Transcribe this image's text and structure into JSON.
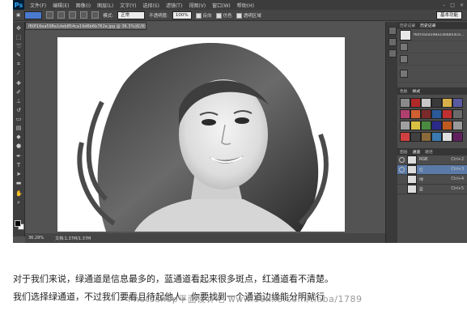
{
  "menubar": {
    "logo": "Ps",
    "items": [
      "文件(F)",
      "编辑(E)",
      "图像(I)",
      "图层(L)",
      "文字(Y)",
      "选择(S)",
      "滤镜(T)",
      "视图(V)",
      "窗口(W)",
      "帮助(H)"
    ],
    "window_controls": [
      "–",
      "□",
      "×"
    ]
  },
  "options": {
    "mode_label": "模式:",
    "mode_value": "正常",
    "opacity_label": "不透明度:",
    "opacity_value": "100%",
    "cb1": "反向",
    "cb2": "仿色",
    "cb3": "透明区域",
    "workspace": "基本功能"
  },
  "document": {
    "tab_title": "f60f16ea598a1deb854ca19d6b6b762e.jpg @ 36.3%(红/8)",
    "zoom": "36.29%",
    "doc_info": "文档:1.37M/1.37M"
  },
  "history": {
    "tabs": [
      "历史记录",
      "历史记录"
    ],
    "rows": [
      "f60f16ea598a1deb854ca...",
      "",
      "",
      ""
    ]
  },
  "styles": {
    "tabs": [
      "色板",
      "样式"
    ],
    "colors": [
      "#8a8a8a",
      "#b02a2a",
      "#c8c8c8",
      "#3a3a3a",
      "#d8b04a",
      "#5a5aa0",
      "#b04070",
      "#d06030",
      "#7a2a2a",
      "#2a5a9a",
      "#c03030",
      "#6a6a6a",
      "#a0a0a0",
      "#d8c040",
      "#4a8a40",
      "#2a2a8a",
      "#c05a20",
      "#9a9a9a",
      "#d04040",
      "#404040",
      "#8a6a3a",
      "#3a7ab0",
      "#e0e0e0",
      "#602060"
    ]
  },
  "channels": {
    "tabs": [
      "图层",
      "通道",
      "路径"
    ],
    "rows": [
      {
        "name": "RGB",
        "key": "Ctrl+2"
      },
      {
        "name": "红",
        "key": "Ctrl+3"
      },
      {
        "name": "绿",
        "key": "Ctrl+4"
      },
      {
        "name": "蓝",
        "key": "Ctrl+5"
      }
    ]
  },
  "caption": {
    "line1": "对于我们来说，绿通道是信息最多的，蓝通道看起来很多斑点，红通道看不清楚。",
    "line2": "我们选择绿通道，不过我们要看且待起他人。你要找到一个通道边缘能分明就行"
  },
  "watermark": "Photoshop平面设计吧  www.16xx8.com/tieba/1789"
}
